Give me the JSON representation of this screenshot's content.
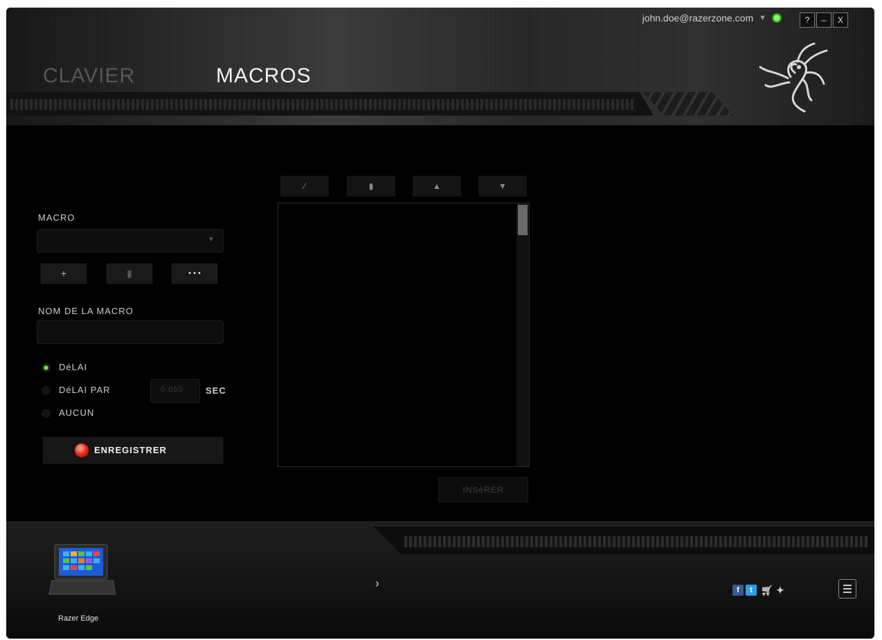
{
  "header": {
    "tabs": [
      {
        "label": "CLAVIER"
      },
      {
        "label": "MACROS"
      }
    ],
    "active_tab": "MACROS",
    "account": "john.doe@razerzone.com",
    "window_buttons": {
      "help": "?",
      "minimize": "–",
      "close": "X"
    }
  },
  "macro_panel": {
    "macro_label": "MACRO",
    "macro_select_value": "",
    "add_button": "+",
    "delete_button": "▮",
    "more_button": "• • •",
    "name_label": "NOM DE LA MACRO",
    "name_value": "",
    "delay_options": [
      {
        "label": "DéLAI",
        "selected": true
      },
      {
        "label": "DéLAI PAR",
        "selected": false
      },
      {
        "label": "AUCUN",
        "selected": false
      }
    ],
    "delay_value": "0.050",
    "delay_unit": "SEC",
    "record_button": "ENREGISTRER",
    "accent_color": "#6ee03a"
  },
  "editor": {
    "toolbar": [
      "edit-icon",
      "delete-icon",
      "move-up-icon",
      "move-down-icon"
    ],
    "insert_button": "INSéRER"
  },
  "footer": {
    "device_name": "Razer Edge",
    "icons": [
      "facebook-icon",
      "twitter-icon",
      "cart-icon",
      "razer-icon",
      "menu-icon"
    ]
  }
}
